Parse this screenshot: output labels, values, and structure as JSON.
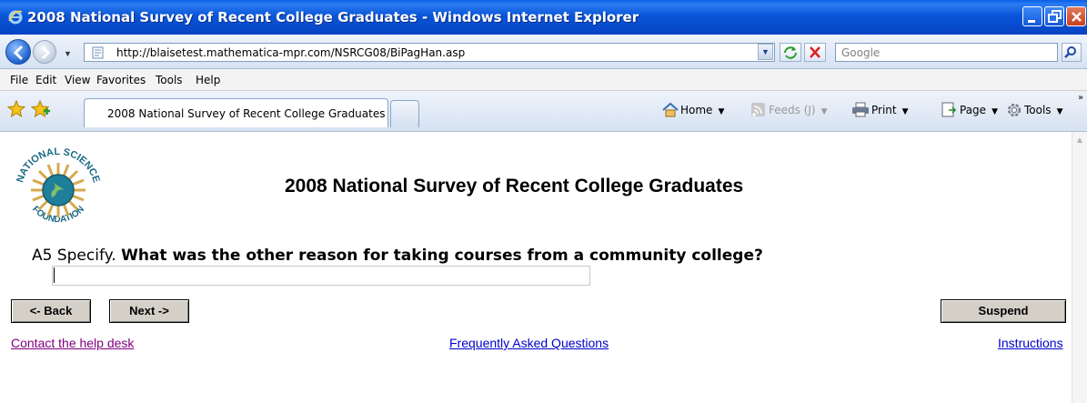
{
  "window": {
    "title": "2008 National Survey of Recent College Graduates - Windows Internet Explorer"
  },
  "address_bar": {
    "url": "http://blaisetest.mathematica-mpr.com/NSRCG08/BiPagHan.asp",
    "search_placeholder": "Google"
  },
  "menu": {
    "items": [
      "File",
      "Edit",
      "View",
      "Favorites",
      "Tools",
      "Help"
    ]
  },
  "tabs": {
    "active_label": "2008 National Survey of Recent College Graduates"
  },
  "command_bar": {
    "home": "Home",
    "feeds": "Feeds (J)",
    "print": "Print",
    "page": "Page",
    "tools": "Tools"
  },
  "page": {
    "title": "2008 National Survey of Recent College Graduates",
    "logo_text_top": "NATIONAL SCIENCE",
    "logo_text_bottom": "FOUNDATION",
    "question_number": "A5 Specify.",
    "question_text": "What was the other reason for taking courses from a community college?",
    "answer_value": "",
    "back_label": "<- Back",
    "next_label": "Next ->",
    "suspend_label": "Suspend",
    "help_link": "Contact the help desk",
    "faq_link": "Frequently Asked Questions",
    "instructions_link": "Instructions"
  },
  "colors": {
    "titlebar": "#0a55d8",
    "visited_link": "#800080",
    "link": "#0000cc",
    "button_face": "#d4d0c8"
  }
}
